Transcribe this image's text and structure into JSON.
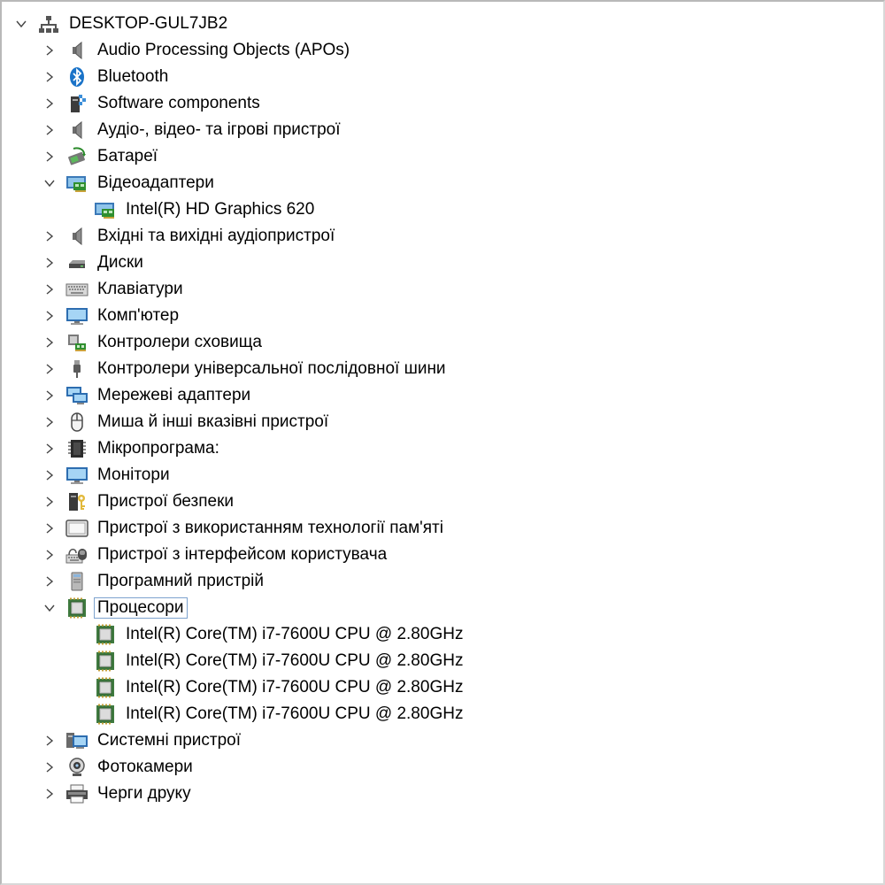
{
  "root": {
    "label": "DESKTOP-GUL7JB2",
    "icon": "computer-network-icon",
    "expanded": true
  },
  "categories": [
    {
      "label": "Audio Processing Objects (APOs)",
      "icon": "speaker-icon",
      "expanded": false
    },
    {
      "label": "Bluetooth",
      "icon": "bluetooth-icon",
      "expanded": false
    },
    {
      "label": "Software components",
      "icon": "software-component-icon",
      "expanded": false
    },
    {
      "label": "Аудіо-, відео- та ігрові пристрої",
      "icon": "speaker-icon",
      "expanded": false
    },
    {
      "label": "Батареї",
      "icon": "battery-icon",
      "expanded": false
    },
    {
      "label": "Відеоадаптери",
      "icon": "display-adapter-icon",
      "expanded": true,
      "children": [
        {
          "label": "Intel(R) HD Graphics 620",
          "icon": "display-adapter-icon"
        }
      ]
    },
    {
      "label": "Вхідні та вихідні аудіопристрої",
      "icon": "speaker-icon",
      "expanded": false
    },
    {
      "label": "Диски",
      "icon": "disk-drive-icon",
      "expanded": false
    },
    {
      "label": "Клавіатури",
      "icon": "keyboard-icon",
      "expanded": false
    },
    {
      "label": "Комп'ютер",
      "icon": "monitor-icon",
      "expanded": false
    },
    {
      "label": "Контролери сховища",
      "icon": "storage-controller-icon",
      "expanded": false
    },
    {
      "label": "Контролери універсальної послідовної шини",
      "icon": "usb-icon",
      "expanded": false
    },
    {
      "label": "Мережеві адаптери",
      "icon": "network-adapter-icon",
      "expanded": false
    },
    {
      "label": "Миша й інші вказівні пристрої",
      "icon": "mouse-icon",
      "expanded": false
    },
    {
      "label": "Мікропрограма:",
      "icon": "firmware-chip-icon",
      "expanded": false
    },
    {
      "label": "Монітори",
      "icon": "monitor-icon",
      "expanded": false
    },
    {
      "label": "Пристрої безпеки",
      "icon": "security-key-icon",
      "expanded": false
    },
    {
      "label": "Пристрої з використанням технології пам'яті",
      "icon": "memory-device-icon",
      "expanded": false
    },
    {
      "label": "Пристрої з інтерфейсом користувача",
      "icon": "hid-icon",
      "expanded": false
    },
    {
      "label": "Програмний пристрій",
      "icon": "software-device-icon",
      "expanded": false
    },
    {
      "label": "Процесори",
      "icon": "processor-icon",
      "expanded": true,
      "selected": true,
      "children": [
        {
          "label": "Intel(R) Core(TM) i7-7600U CPU @ 2.80GHz",
          "icon": "processor-icon"
        },
        {
          "label": "Intel(R) Core(TM) i7-7600U CPU @ 2.80GHz",
          "icon": "processor-icon"
        },
        {
          "label": "Intel(R) Core(TM) i7-7600U CPU @ 2.80GHz",
          "icon": "processor-icon"
        },
        {
          "label": "Intel(R) Core(TM) i7-7600U CPU @ 2.80GHz",
          "icon": "processor-icon"
        }
      ]
    },
    {
      "label": "Системні пристрої",
      "icon": "system-device-icon",
      "expanded": false
    },
    {
      "label": "Фотокамери",
      "icon": "camera-icon",
      "expanded": false
    },
    {
      "label": "Черги друку",
      "icon": "printer-icon",
      "expanded": false
    }
  ],
  "colors": {
    "selection_border": "#7da2ce",
    "chevron": "#444444",
    "processor_green": "#3f7a3f"
  }
}
